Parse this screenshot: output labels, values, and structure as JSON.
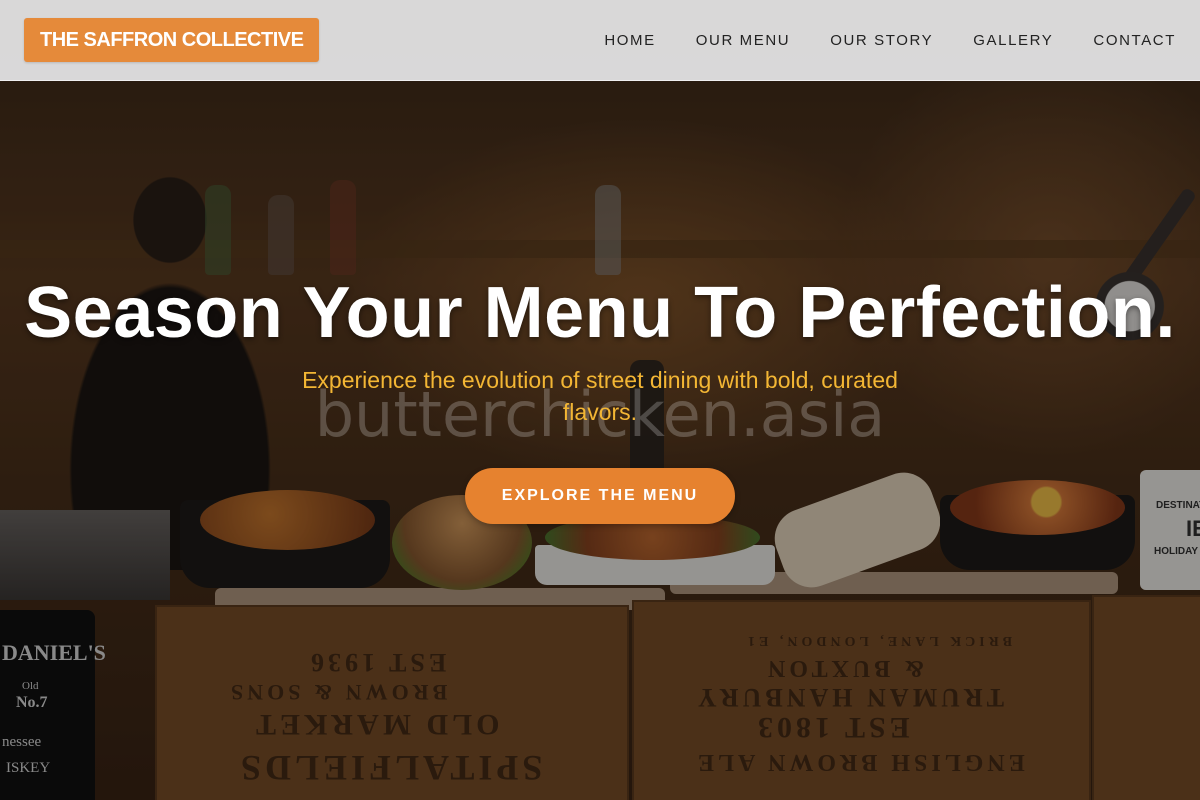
{
  "brand": {
    "name": "THE SAFFRON COLLECTIVE",
    "accent_color": "#e58a3a"
  },
  "nav": {
    "items": [
      {
        "label": "HOME"
      },
      {
        "label": "OUR MENU"
      },
      {
        "label": "OUR STORY"
      },
      {
        "label": "GALLERY"
      },
      {
        "label": "CONTACT"
      }
    ]
  },
  "hero": {
    "headline": "Season Your Menu To Perfection.",
    "subtitle": "Experience the evolution of street dining with bold, curated flavors.",
    "subtitle_color": "#f3b634",
    "cta_label": "EXPLORE THE MENU",
    "cta_color": "#e6822f",
    "watermark": "butterchicken.asia",
    "background_image": "food-stall-photo",
    "photo_text": {
      "crate_left": [
        "EST 1936",
        "BROWN & SONS",
        "OLD MARKET",
        "SPITALFIELDS"
      ],
      "crate_right": [
        "BRICK LANE, LONDON, E1",
        "& BUXTON",
        "TRUMAN HANBURY",
        "EST 1803",
        "ENGLISH BROWN ALE"
      ],
      "bottle_label": [
        "DANIEL'S",
        "Old",
        "No.7",
        "nessee",
        "ISKEY"
      ],
      "mug_label": [
        "DESTINAT",
        "IE",
        "HOLIDAY"
      ]
    }
  }
}
